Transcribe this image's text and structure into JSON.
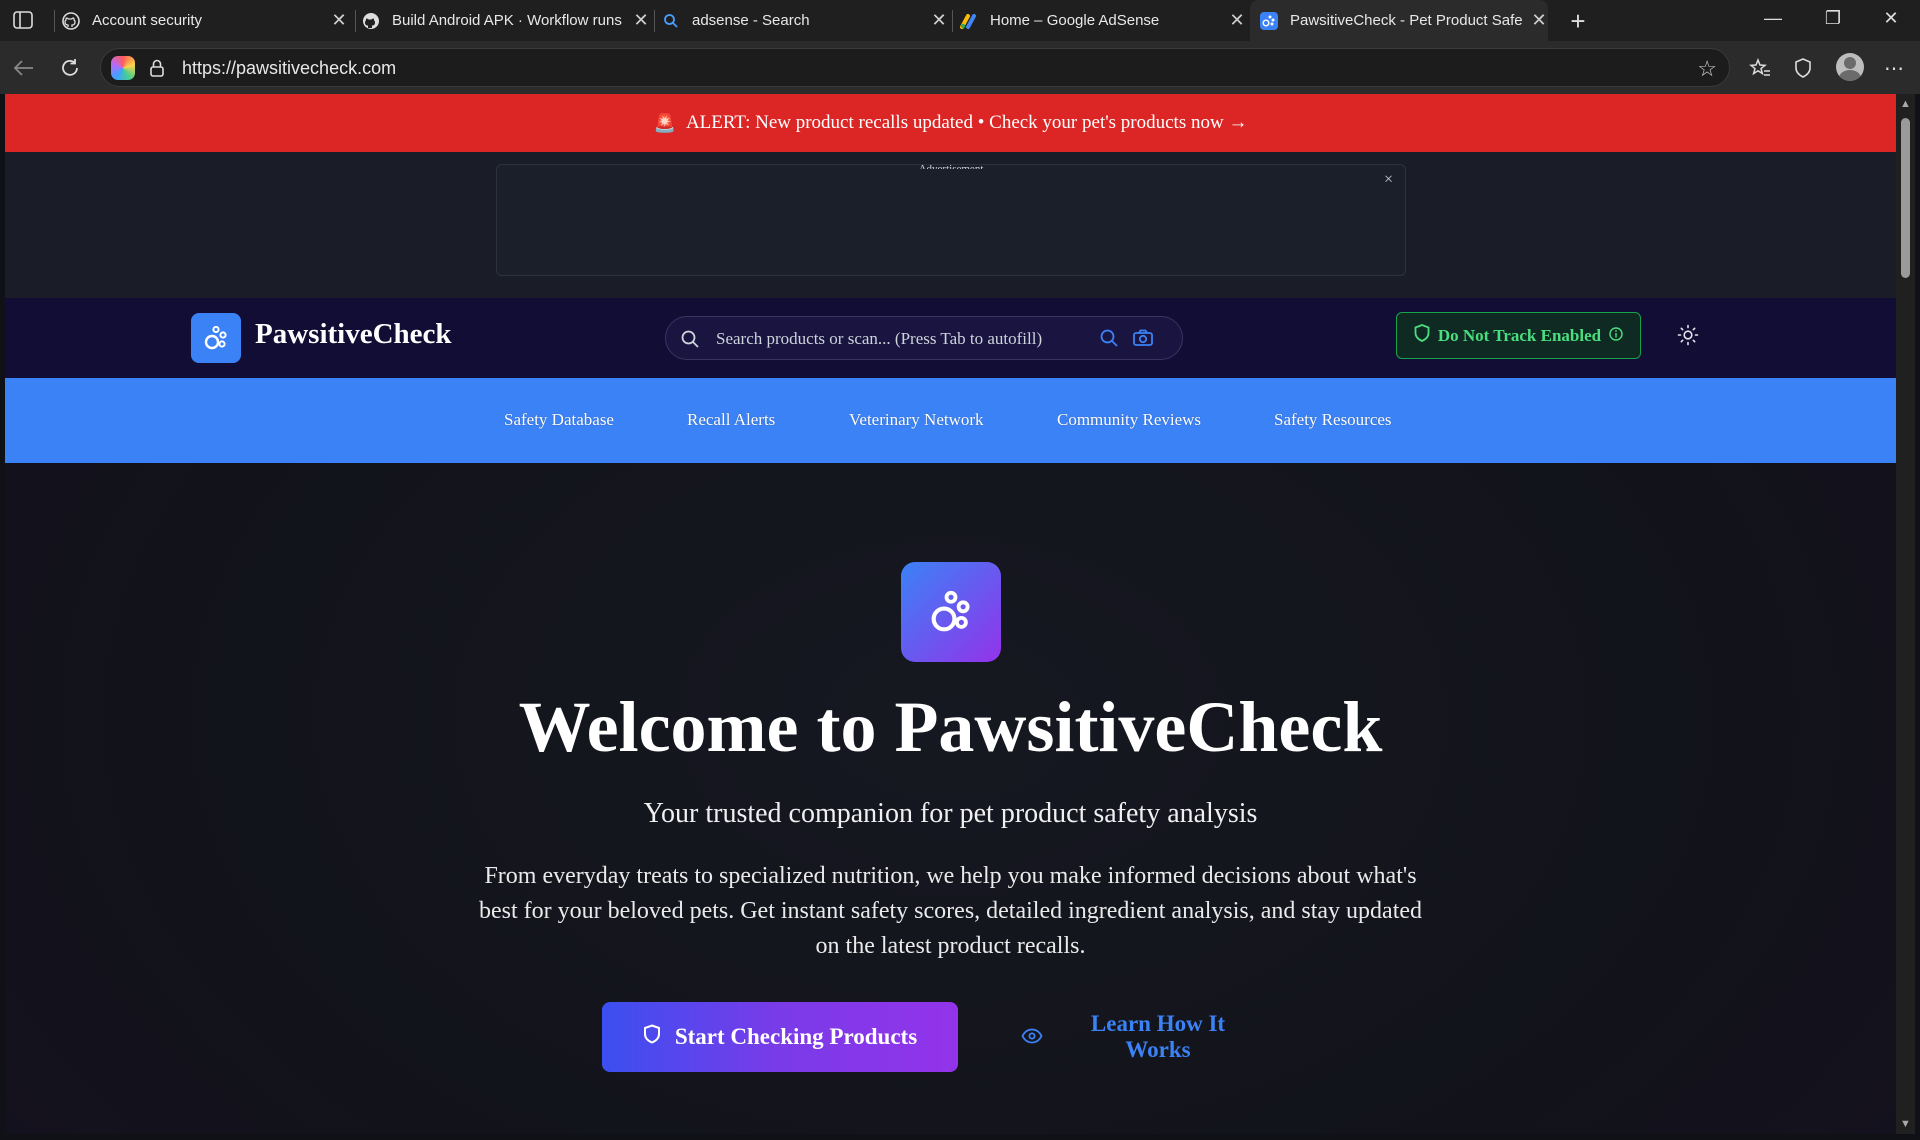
{
  "browser": {
    "tabs": [
      {
        "title": "Account security",
        "icon": "github-icon",
        "active": false
      },
      {
        "title": "Build Android APK · Workflow runs",
        "icon": "github-icon",
        "active": false
      },
      {
        "title": "adsense - Search",
        "icon": "search-icon",
        "active": false
      },
      {
        "title": "Home – Google AdSense",
        "icon": "adsense-icon",
        "active": false
      },
      {
        "title": "PawsitiveCheck - Pet Product Safety",
        "icon": "paw-icon",
        "active": true
      }
    ],
    "url": "https://pawsitivecheck.com"
  },
  "alert": {
    "text": "ALERT: New product recalls updated • Check your pet's products now →",
    "color": "#dc2626"
  },
  "ad": {
    "label": "Advertisement",
    "close": "×"
  },
  "header": {
    "brand": "PawsitiveCheck",
    "search_placeholder": "Search products or scan... (Press Tab to autofill)",
    "dnt_label": "Do Not Track Enabled"
  },
  "nav": {
    "items": [
      {
        "label": "Safety Database"
      },
      {
        "label": "Recall Alerts"
      },
      {
        "label": "Veterinary Network"
      },
      {
        "label": "Community Reviews"
      },
      {
        "label": "Safety Resources"
      }
    ]
  },
  "hero": {
    "title": "Welcome to PawsitiveCheck",
    "subtitle": "Your trusted companion for pet product safety analysis",
    "description": "From everyday treats to specialized nutrition, we help you make informed decisions about what's best for your beloved pets. Get instant safety scores, detailed ingredient analysis, and stay updated on the latest product recalls.",
    "primary_cta": "Start Checking Products",
    "secondary_cta": "Learn How It Works"
  },
  "colors": {
    "header_bg": "#110d35",
    "nav_bg": "#3b82f6",
    "accent": "#3b82f6",
    "dnt": "#4ade80",
    "cta_gradient": [
      "#3b4ff0",
      "#9333ea"
    ]
  }
}
